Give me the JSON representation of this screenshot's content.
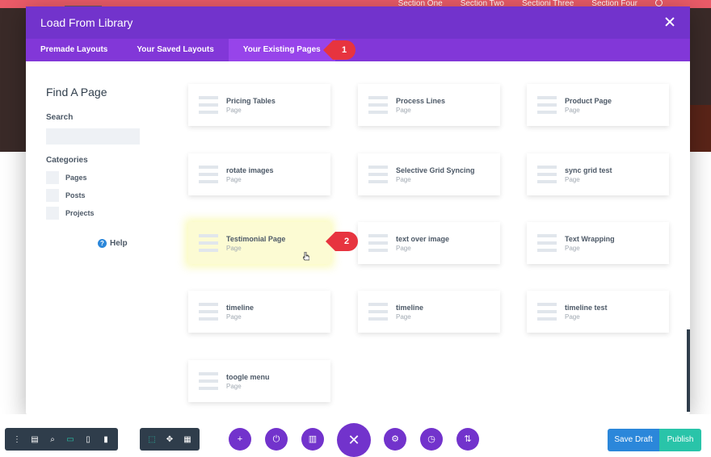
{
  "background": {
    "nav_items": [
      "Section One",
      "Section Two",
      "Sectioni Three",
      "Section Four"
    ]
  },
  "modal": {
    "title": "Load From Library",
    "tabs": [
      {
        "label": "Premade Layouts"
      },
      {
        "label": "Your Saved Layouts"
      },
      {
        "label": "Your Existing Pages",
        "active": true
      }
    ]
  },
  "sidebar": {
    "title": "Find A Page",
    "search_label": "Search",
    "search_value": "",
    "categories_label": "Categories",
    "categories": [
      "Pages",
      "Posts",
      "Projects"
    ],
    "help_label": "Help"
  },
  "pages": [
    {
      "name": "Pricing Tables",
      "type": "Page"
    },
    {
      "name": "Process Lines",
      "type": "Page"
    },
    {
      "name": "Product Page",
      "type": "Page"
    },
    {
      "name": "rotate images",
      "type": "Page"
    },
    {
      "name": "Selective Grid Syncing",
      "type": "Page"
    },
    {
      "name": "sync grid test",
      "type": "Page"
    },
    {
      "name": "Testimonial Page",
      "type": "Page",
      "highlighted": true
    },
    {
      "name": "text over image",
      "type": "Page"
    },
    {
      "name": "Text Wrapping",
      "type": "Page"
    },
    {
      "name": "timeline",
      "type": "Page"
    },
    {
      "name": "timeline",
      "type": "Page"
    },
    {
      "name": "timeline test",
      "type": "Page"
    },
    {
      "name": "toogle menu",
      "type": "Page"
    }
  ],
  "callouts": [
    "1",
    "2"
  ],
  "bottom_bar": {
    "left_tools": [
      "menu-icon",
      "wireframe-icon",
      "zoom-icon",
      "desktop-icon",
      "tablet-icon",
      "phone-icon"
    ],
    "right_tools": [
      "select-icon",
      "hover-icon",
      "grid-icon"
    ],
    "actions": [
      "add-icon",
      "power-icon",
      "trash-icon",
      "close-icon",
      "settings-icon",
      "history-icon",
      "sort-icon"
    ],
    "save_draft_label": "Save Draft",
    "publish_label": "Publish"
  },
  "colors": {
    "accent": "#7233cc",
    "tab_active": "#9744ea",
    "callout": "#e7343f",
    "draft": "#2b87da",
    "publish": "#29c4a9"
  }
}
